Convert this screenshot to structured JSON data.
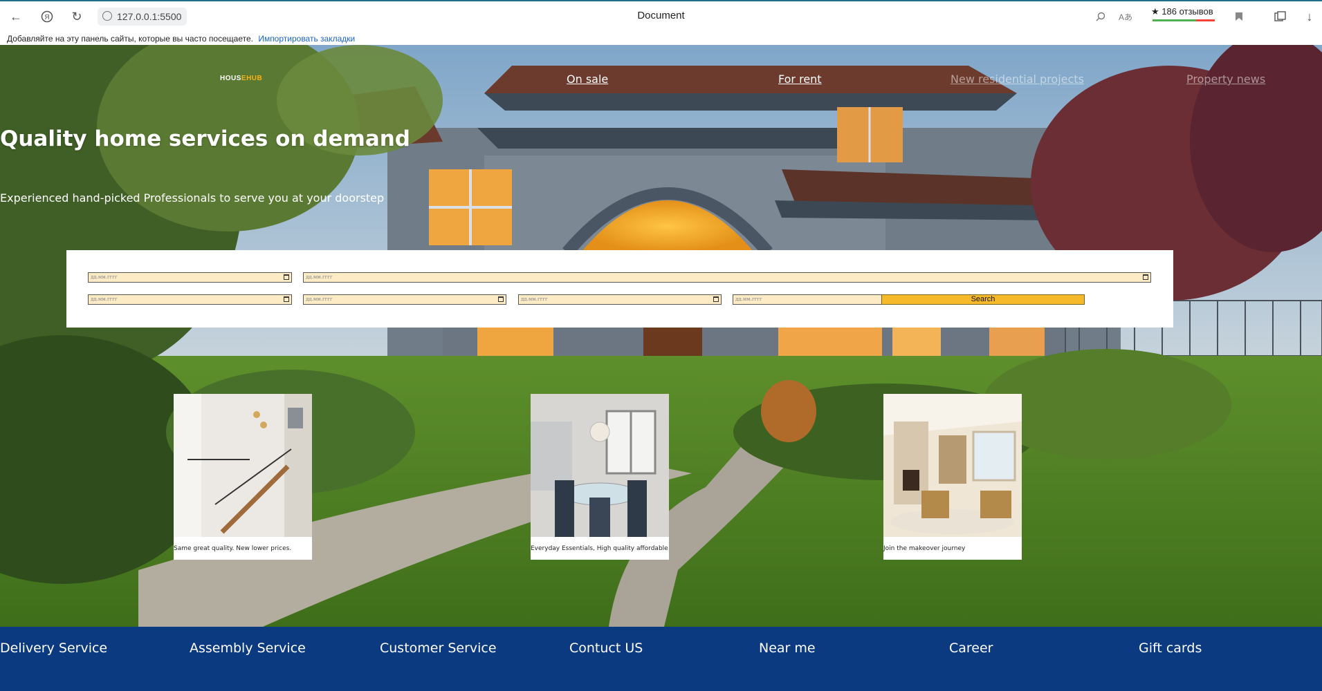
{
  "browser": {
    "url": "127.0.0.1:5500",
    "tab_title": "Document",
    "reviews": "★ 186 отзывов",
    "bookmarks_prompt": "Добавляйте на эту панель сайты, которые вы часто посещаете.",
    "bookmarks_import": "Импортировать закладки"
  },
  "header": {
    "logo_main": "HOUS",
    "logo_accent": "EHUB",
    "nav": [
      "On sale",
      "For rent",
      "New residential projects",
      "Property news"
    ]
  },
  "hero": {
    "title": "Quality home services on demand",
    "subtitle": "Experienced hand-picked Professionals to serve you at your doorstep"
  },
  "search": {
    "date_placeholder": "дд.мм.гггг",
    "button_label": "Search"
  },
  "cards": [
    {
      "caption": "Same great quality. New lower prices."
    },
    {
      "caption": "Everyday Essentials, High quality affordable"
    },
    {
      "caption": "Join the makeover journey"
    }
  ],
  "footer": {
    "links": [
      "Delivery Service",
      "Assembly Service",
      "Customer Service",
      "Contuct US",
      "Near me",
      "Career",
      "Gift cards"
    ]
  },
  "colors": {
    "accent": "#f5b92a",
    "footer_bg": "#0b3a80",
    "field_bg": "#fdebc6"
  }
}
